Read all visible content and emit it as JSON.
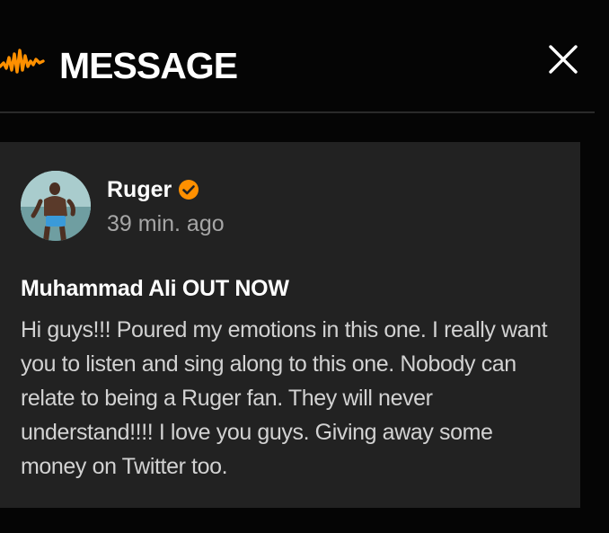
{
  "header": {
    "title": "MESSAGE",
    "logo_icon": "audiomack-waveform-icon",
    "close_icon": "close-icon",
    "brand_color": "#ff9000"
  },
  "post": {
    "author": "Ruger",
    "verified_icon": "verified-badge-icon",
    "timestamp": "39 min. ago",
    "title": "Muhammad Ali OUT NOW",
    "body": "Hi guys!!! Poured my emotions in this one. I really want you to listen and sing along to this one. Nobody can relate to being a Ruger fan. They will never understand!!!! I love you guys. Giving away some money on Twitter too."
  },
  "colors": {
    "background": "#050505",
    "card": "#222222",
    "accent": "#ff9000",
    "muted_text": "#a6a6a6"
  }
}
